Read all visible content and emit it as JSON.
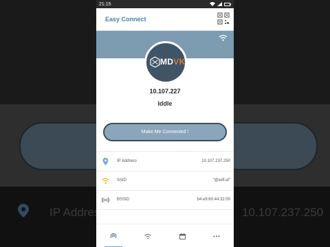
{
  "status_bar": {
    "time": "21:15"
  },
  "app": {
    "title": "Easy Connect"
  },
  "logo": {
    "text_md": "MD",
    "text_vk": "VK"
  },
  "connection": {
    "ip": "10.107.227",
    "state": "Iddle",
    "button_label": "Make Me Connected !"
  },
  "info": [
    {
      "icon": "location-pin-icon",
      "label": "IP Address",
      "value": "10.107.237.250"
    },
    {
      "icon": "wifi-icon",
      "label": "SSID",
      "value": "\"@wifi.id\""
    },
    {
      "icon": "signal-icon",
      "label": "BSSID",
      "value": "b4:e9:60:44:32:00"
    }
  ],
  "background": {
    "ip_label": "IP Address",
    "ip_value": "10.107.237.250"
  },
  "nav": [
    "hotspot-icon",
    "wifi-icon",
    "calendar-icon",
    "more-icon"
  ],
  "colors": {
    "accent": "#7d9cb1",
    "title": "#4d7fa6",
    "logo_bg": "#3f5466",
    "logo_vk": "#e07a2e"
  }
}
